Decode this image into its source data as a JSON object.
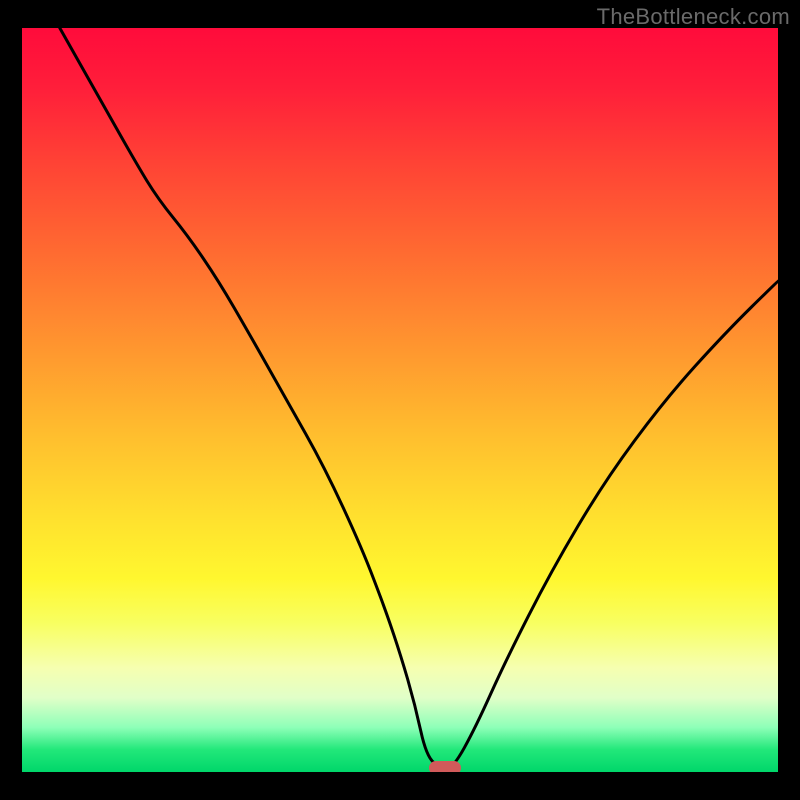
{
  "watermark": "TheBottleneck.com",
  "chart_data": {
    "type": "line",
    "title": "",
    "xlabel": "",
    "ylabel": "",
    "xlim": [
      0,
      100
    ],
    "ylim": [
      0,
      100
    ],
    "grid": false,
    "legend": false,
    "series": [
      {
        "name": "bottleneck-curve",
        "x": [
          5,
          10,
          15,
          18,
          22,
          26,
          30,
          35,
          40,
          45,
          48,
          50,
          52,
          53.5,
          55.5,
          57,
          60,
          64,
          70,
          77,
          85,
          93,
          100
        ],
        "y": [
          100,
          91,
          82,
          77,
          72,
          66,
          59,
          50,
          41,
          30,
          22,
          16,
          9,
          2,
          0.5,
          0.5,
          6,
          15,
          27,
          39,
          50,
          59,
          66
        ]
      }
    ],
    "marker": {
      "x": 56,
      "y": 0.6
    },
    "background_gradient": {
      "stops": [
        {
          "pos": 0.0,
          "color": "#ff0b3b"
        },
        {
          "pos": 0.18,
          "color": "#ff4235"
        },
        {
          "pos": 0.43,
          "color": "#ff962f"
        },
        {
          "pos": 0.66,
          "color": "#ffe12e"
        },
        {
          "pos": 0.86,
          "color": "#f6ffb0"
        },
        {
          "pos": 0.97,
          "color": "#22e87a"
        },
        {
          "pos": 1.0,
          "color": "#00d66a"
        }
      ]
    }
  },
  "colors": {
    "frame": "#000000",
    "curve": "#000000",
    "marker": "#d15a5a",
    "watermark": "#6a6a6a"
  }
}
